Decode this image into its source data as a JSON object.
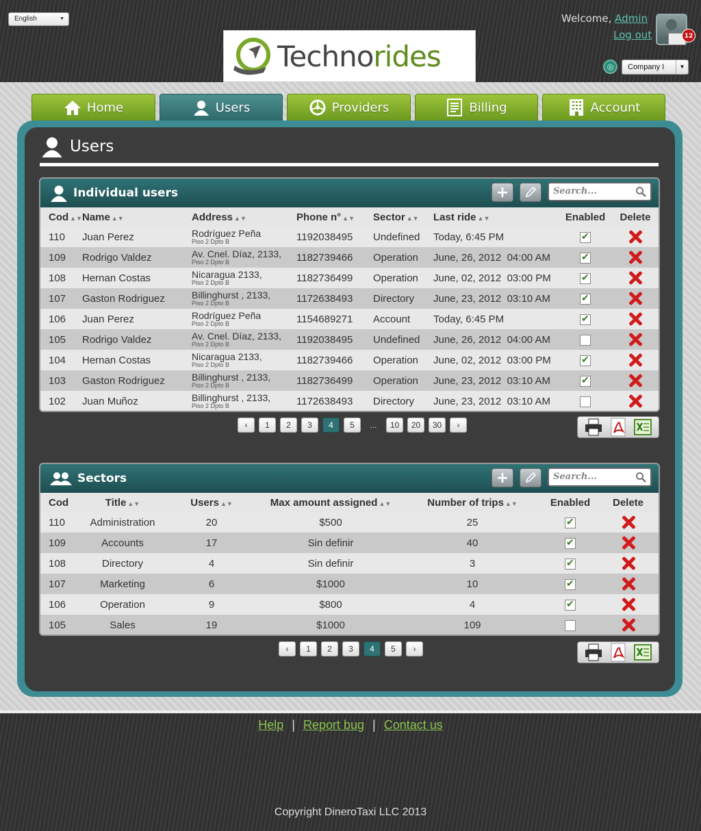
{
  "header": {
    "language": "English",
    "logo_part1": "Techno",
    "logo_part2": "rides",
    "welcome_text": "Welcome,",
    "user_name": "Admin",
    "logout": "Log out",
    "notification_count": "12",
    "company": "Company I"
  },
  "nav": {
    "items": [
      {
        "label": "Home"
      },
      {
        "label": "Users"
      },
      {
        "label": "Providers"
      },
      {
        "label": "Billing"
      },
      {
        "label": "Account"
      }
    ]
  },
  "page": {
    "title": "Users"
  },
  "individual_users": {
    "title": "Individual users",
    "search_placeholder": "Search...",
    "columns": [
      "Cod",
      "Name",
      "Address",
      "Phone n°",
      "Sector",
      "Last ride",
      "Enabled",
      "Delete"
    ],
    "rows": [
      {
        "cod": "110",
        "name": "Juan Perez",
        "address": "Rodríguez Peña",
        "address2": "Piso 2 Dpto B",
        "phone": "1192038495",
        "sector": "Undefined",
        "last_ride": "Today, 6:45 PM",
        "enabled": true
      },
      {
        "cod": "109",
        "name": "Rodrigo Valdez",
        "address": "Av. Cnel. Díaz, 2133,",
        "address2": "Piso 2 Dpto B",
        "phone": "1182739466",
        "sector": "Operation",
        "last_ride": "June, 26, 2012  04:00 AM",
        "enabled": true
      },
      {
        "cod": "108",
        "name": "Hernan Costas",
        "address": "Nicaragua 2133,",
        "address2": "Piso 2 Dpto B",
        "phone": "1182736499",
        "sector": "Operation",
        "last_ride": "June, 02, 2012  03:00 PM",
        "enabled": true
      },
      {
        "cod": "107",
        "name": "Gaston Rodriguez",
        "address": "Billinghurst , 2133,",
        "address2": "Piso 2 Dpto B",
        "phone": "1172638493",
        "sector": "Directory",
        "last_ride": "June, 23, 2012  03:10 AM",
        "enabled": true
      },
      {
        "cod": "106",
        "name": "Juan Perez",
        "address": "Rodríguez Peña",
        "address2": "Piso 2 Dpto B",
        "phone": "1154689271",
        "sector": "Account",
        "last_ride": "Today, 6:45 PM",
        "enabled": true
      },
      {
        "cod": "105",
        "name": "Rodrigo Valdez",
        "address": "Av. Cnel. Díaz, 2133,",
        "address2": "Piso 2 Dpto B",
        "phone": "1192038495",
        "sector": "Undefined",
        "last_ride": "June, 26, 2012  04:00 AM",
        "enabled": false
      },
      {
        "cod": "104",
        "name": "Hernan Costas",
        "address": "Nicaragua 2133,",
        "address2": "Piso 2 Dpto B",
        "phone": "1182739466",
        "sector": "Operation",
        "last_ride": "June, 02, 2012  03:00 PM",
        "enabled": true
      },
      {
        "cod": "103",
        "name": "Gaston Rodriguez",
        "address": "Billinghurst , 2133,",
        "address2": "Piso 2 Dpto B",
        "phone": "1182736499",
        "sector": "Operation",
        "last_ride": "June, 23, 2012  03:10 AM",
        "enabled": true
      },
      {
        "cod": "102",
        "name": "Juan Muñoz",
        "address": "Billinghurst , 2133,",
        "address2": "Piso 2 Dpto B",
        "phone": "1172638493",
        "sector": "Directory",
        "last_ride": "June, 23, 2012  03:10 AM",
        "enabled": false
      }
    ],
    "pages": [
      "1",
      "2",
      "3",
      "4",
      "5",
      "...",
      "10",
      "20",
      "30"
    ],
    "current_page": "4"
  },
  "sectors": {
    "title": "Sectors",
    "search_placeholder": "Search...",
    "columns": [
      "Cod",
      "Title",
      "Users",
      "Max amount assigned",
      "Number of trips",
      "Enabled",
      "Delete"
    ],
    "rows": [
      {
        "cod": "110",
        "title": "Administration",
        "users": "20",
        "max": "$500",
        "trips": "25",
        "enabled": true
      },
      {
        "cod": "109",
        "title": "Accounts",
        "users": "17",
        "max": "Sin definir",
        "trips": "40",
        "enabled": true
      },
      {
        "cod": "108",
        "title": "Directory",
        "users": "4",
        "max": "Sin definir",
        "trips": "3",
        "enabled": true
      },
      {
        "cod": "107",
        "title": "Marketing",
        "users": "6",
        "max": "$1000",
        "trips": "10",
        "enabled": true
      },
      {
        "cod": "106",
        "title": "Operation",
        "users": "9",
        "max": "$800",
        "trips": "4",
        "enabled": true
      },
      {
        "cod": "105",
        "title": "Sales",
        "users": "19",
        "max": "$1000",
        "trips": "109",
        "enabled": false
      }
    ],
    "pages": [
      "1",
      "2",
      "3",
      "4",
      "5"
    ],
    "current_page": "4"
  },
  "footer": {
    "links": [
      "Help",
      "Report bug",
      "Contact us"
    ],
    "copyright": "Copyright DineroTaxi LLC 2013"
  },
  "colors": {
    "accent_teal": "#2f7275",
    "nav_green": "#7fae2a",
    "delete_red": "#d11a1a"
  }
}
